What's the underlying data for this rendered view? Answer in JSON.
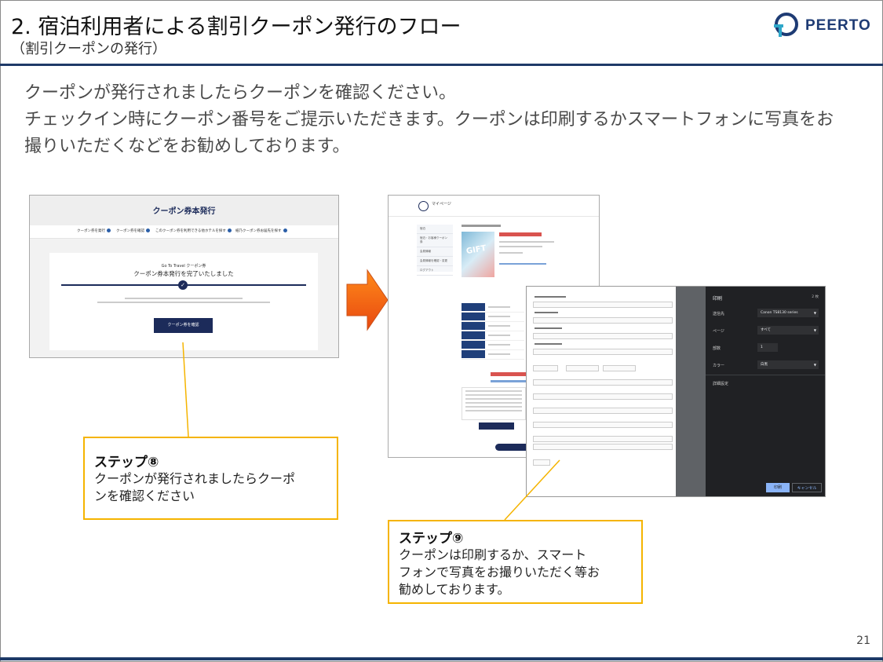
{
  "header": {
    "title": "2. 宿泊利用者による割引クーポン発行のフロー",
    "subtitle": "（割引クーポンの発行）",
    "logo_text": "PEERTO"
  },
  "body_lines": [
    "クーポンが発行されましたらクーポンを確認ください。",
    "チェックイン時にクーポン番号をご提示いただきます。クーポンは印刷するかスマートフォンに写真をお",
    "撮りいただくなどをお勧めしております。"
  ],
  "screenshot1": {
    "header": "クーポン券本発行",
    "steps": [
      "クーポン券を発行",
      "クーポン券を確認",
      "このクーポン券を利用できる他ホテルを探す",
      "紙乃クーポン券お届先を探す"
    ],
    "small_label": "Go To Travel クーポン券",
    "complete_text": "クーポン券本発行を完了いたしました",
    "button": "クーポン券を確認"
  },
  "screenshot2": {
    "mypage_label": "マイページ",
    "sidebar": [
      "宿泊",
      "宿泊・お客様クーポン券",
      "会員情報",
      "会員情報を確認・変更",
      "ログアウト"
    ],
    "gift_text": "GIFT"
  },
  "screenshot3": {
    "dialog_title": "印刷",
    "page_count": "2 枚",
    "labels": {
      "destination": "送信先",
      "pages": "ページ",
      "copies": "部数",
      "color": "カラー",
      "more": "詳細設定"
    },
    "values": {
      "destination": "Canon TS8130 series",
      "pages": "すべて",
      "copies": "1",
      "color": "白黒"
    },
    "print_button": "印刷",
    "cancel_button": "キャンセル"
  },
  "callouts": [
    {
      "heading": "ステップ⑧",
      "lines": [
        "クーポンが発行されましたらクーポ",
        "ンを確認ください"
      ]
    },
    {
      "heading": "ステップ⑨",
      "lines": [
        "クーポンは印刷するか、スマート",
        "フォンで写真をお撮りいただく等お",
        "勧めしております。"
      ]
    }
  ],
  "page_number": "21",
  "colors": {
    "navy": "#1e3a68",
    "callout_border": "#f5b400",
    "arrow": "#f05a14"
  }
}
